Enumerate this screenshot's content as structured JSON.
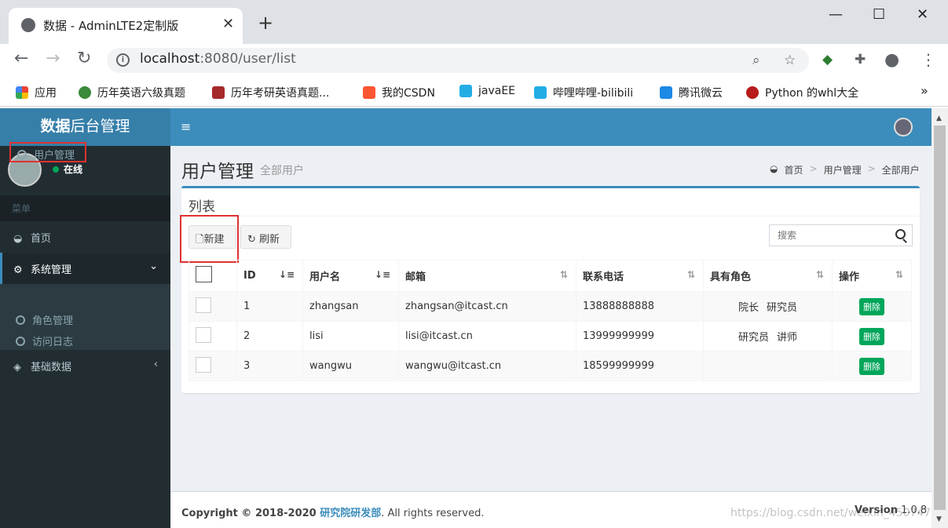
{
  "browser": {
    "tab_title": "数据 - AdminLTE2定制版",
    "tab_close": "✕",
    "new_tab": "+",
    "url_host": "localhost",
    "url_rest": ":8080/user/list",
    "bookmarks": [
      {
        "label": "应用",
        "color": "#ea4335"
      },
      {
        "label": "历年英语六级真题",
        "color": "#3a8a3a"
      },
      {
        "label": "历年考研英语真题...",
        "color": "#a52a2a"
      },
      {
        "label": "我的CSDN",
        "color": "#fc5531"
      },
      {
        "label": "javaEE",
        "color": "#23ade5"
      },
      {
        "label": "哔哩哔哩-bilibili",
        "color": "#23ade5"
      },
      {
        "label": "腾讯微云",
        "color": "#1e88e5"
      },
      {
        "label": "Python 的whl大全",
        "color": "#b71c1c"
      }
    ],
    "bookmarks_more": "»"
  },
  "app": {
    "logo_bold": "数据",
    "logo_rest": "后台管理",
    "user_status": "在线",
    "menu_header": "菜单",
    "menu": {
      "home": "首页",
      "system": "系统管理",
      "user_mgmt": "用户管理",
      "role_mgmt": "角色管理",
      "access_log": "访问日志",
      "base_data": "基础数据"
    },
    "page_title": "用户管理",
    "page_subtitle": "全部用户",
    "breadcrumb": [
      "首页",
      "用户管理",
      "全部用户"
    ],
    "box_title": "列表",
    "btn_new": "新建",
    "btn_refresh": "刷新",
    "search_placeholder": "搜索",
    "columns": [
      "ID",
      "用户名",
      "邮箱",
      "联系电话",
      "具有角色",
      "操作"
    ],
    "rows": [
      {
        "id": "1",
        "username": "zhangsan",
        "email": "zhangsan@itcast.cn",
        "phone": "13888888888",
        "roles": [
          "院长",
          "研究员"
        ]
      },
      {
        "id": "2",
        "username": "lisi",
        "email": "lisi@itcast.cn",
        "phone": "13999999999",
        "roles": [
          "研究员",
          "讲师"
        ]
      },
      {
        "id": "3",
        "username": "wangwu",
        "email": "wangwu@itcast.cn",
        "phone": "18599999999",
        "roles": []
      }
    ],
    "delete_label": "删除",
    "footer_copy": "Copyright © 2018-2020 ",
    "footer_org": "研究院研发部",
    "footer_rights": ". All rights reserved.",
    "footer_version_label": "Version",
    "footer_version": "1.0.8",
    "watermark": "https://blog.csdn.net/weixin_45074724"
  },
  "colors": {
    "primary": "#3c8dbc",
    "sidebar": "#222d32",
    "success": "#00a65a",
    "highlight": "#e03131"
  }
}
